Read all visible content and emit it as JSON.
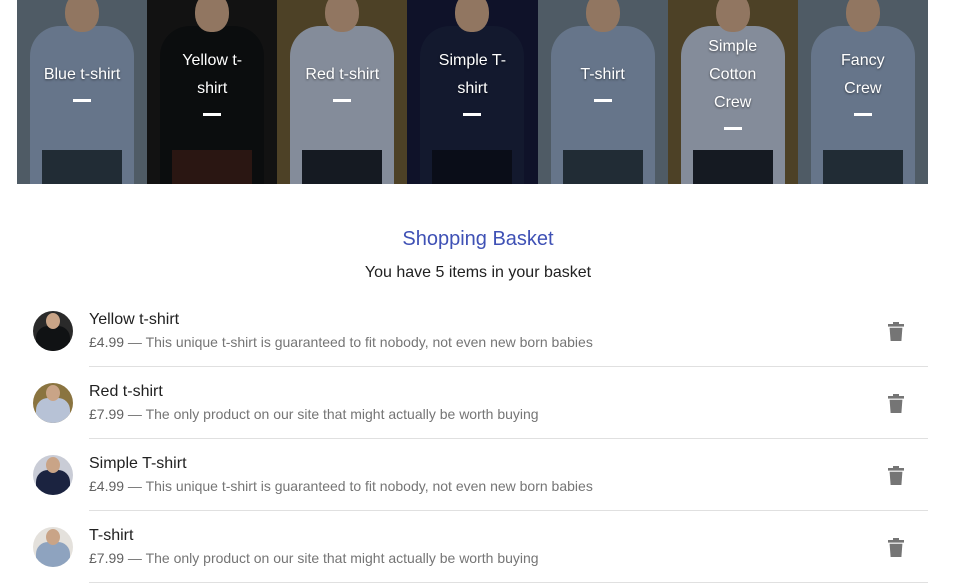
{
  "products": [
    {
      "name": "Blue t-shirt",
      "shirt_color": "#8ea3bf",
      "bg": "#6e7f8c",
      "pants": "#2f3d4a"
    },
    {
      "name": "Yellow t-shirt",
      "shirt_color": "#101214",
      "bg": "#1a1a1a",
      "pants": "#3b1f1a"
    },
    {
      "name": "Red t-shirt",
      "shirt_color": "#b7c2d6",
      "bg": "#6b5a35",
      "pants": "#1e2530"
    },
    {
      "name": "Simple T-shirt",
      "shirt_color": "#1b2340",
      "bg": "#15193a",
      "pants": "#0f1222"
    },
    {
      "name": "T-shirt",
      "shirt_color": "#8ea3bf",
      "bg": "#6e7f8c",
      "pants": "#2f3d4a"
    },
    {
      "name": "Simple Cotton Crew",
      "shirt_color": "#b7c2d6",
      "bg": "#6b5a35",
      "pants": "#1e2530"
    },
    {
      "name": "Fancy Crew",
      "shirt_color": "#8ea3bf",
      "bg": "#6e7f8c",
      "pants": "#2f3d4a"
    }
  ],
  "basket": {
    "title": "Shopping Basket",
    "subtitle": "You have 5 items in your basket",
    "items": [
      {
        "name": "Yellow t-shirt",
        "price": "£4.99",
        "description": " — This unique t-shirt is guaranteed to fit nobody, not even new born babies",
        "shirt_color": "#101214",
        "bg": "#2a2a2a"
      },
      {
        "name": "Red t-shirt",
        "price": "£7.99",
        "description": " — The only product on our site that might actually be worth buying",
        "shirt_color": "#b7c2d6",
        "bg": "#8a7440"
      },
      {
        "name": "Simple T-shirt",
        "price": "£4.99",
        "description": " — This unique t-shirt is guaranteed to fit nobody, not even new born babies",
        "shirt_color": "#1b2340",
        "bg": "#c9ccd6"
      },
      {
        "name": "T-shirt",
        "price": "£7.99",
        "description": " — The only product on our site that might actually be worth buying",
        "shirt_color": "#8ea3bf",
        "bg": "#e4e1dc"
      }
    ]
  },
  "colors": {
    "accent": "#3f51b5",
    "delete_icon": "#757575"
  },
  "icons": {
    "delete": "delete-icon"
  }
}
